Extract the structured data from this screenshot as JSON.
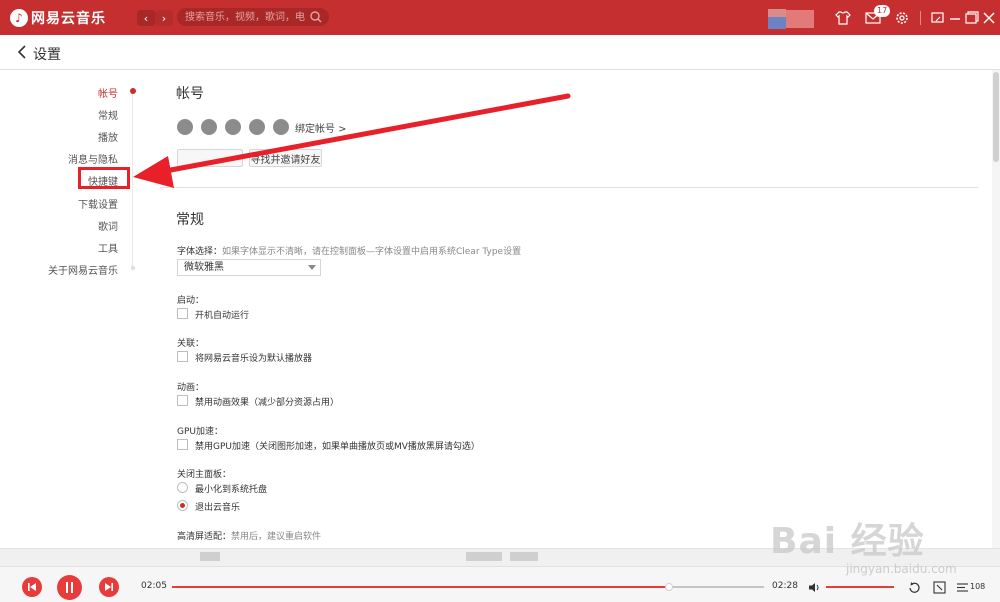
{
  "app": {
    "title": "网易云音乐"
  },
  "search": {
    "placeholder": "搜索音乐，视频，歌词，电台"
  },
  "topbar": {
    "message_count": "17"
  },
  "settings": {
    "back_label": "设置"
  },
  "sidebar": {
    "items": [
      {
        "label": "帐号",
        "active": true
      },
      {
        "label": "常规"
      },
      {
        "label": "播放"
      },
      {
        "label": "消息与隐私"
      },
      {
        "label": "快捷键"
      },
      {
        "label": "下载设置"
      },
      {
        "label": "歌词"
      },
      {
        "label": "工具"
      },
      {
        "label": "关于网易云音乐"
      }
    ]
  },
  "account": {
    "heading": "帐号",
    "bind_label": "绑定帐号 >",
    "find_friends_label": "寻找并邀请好友"
  },
  "general": {
    "heading": "常规",
    "font_label": "字体选择：",
    "font_hint": "如果字体显示不清晰，请在控制面板—字体设置中启用系统Clear Type设置",
    "font_value": "微软雅黑",
    "startup_label": "启动：",
    "startup_opt": "开机自动运行",
    "assoc_label": "关联：",
    "assoc_opt": "将网易云音乐设为默认播放器",
    "anim_label": "动画：",
    "anim_opt": "禁用动画效果（减少部分资源占用）",
    "gpu_label": "GPU加速：",
    "gpu_opt": "禁用GPU加速（关闭图形加速，如果单曲播放页或MV播放黑屏请勾选）",
    "close_label": "关闭主面板：",
    "close_opt1": "最小化到系统托盘",
    "close_opt2": "退出云音乐",
    "hidpi_label": "高清屏适配：",
    "hidpi_hint": "禁用后，建议重启软件"
  },
  "player": {
    "elapsed": "02:05",
    "duration": "02:28",
    "progress": 0.84,
    "volume": 1.0,
    "playlist_count": "108"
  },
  "watermark": {
    "text": "Bai 经验",
    "sub": "jingyan.baidu.com"
  },
  "colors": {
    "accent": "#c62f2f",
    "annotation": "#e8202a"
  }
}
